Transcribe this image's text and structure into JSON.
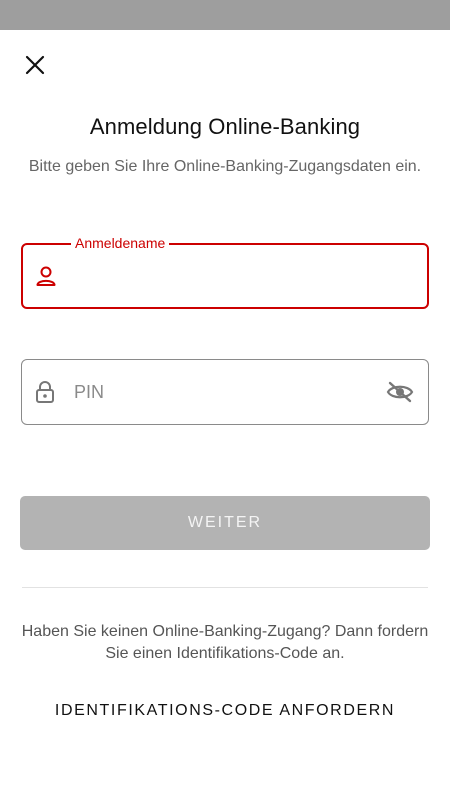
{
  "header": {
    "close_icon": "close-icon",
    "title": "Anmeldung Online-Banking",
    "subtitle": "Bitte geben Sie Ihre Online-Banking-Zugangsdaten ein."
  },
  "form": {
    "username": {
      "label": "Anmeldename",
      "value": "",
      "icon": "user-icon"
    },
    "pin": {
      "placeholder": "PIN",
      "value": "",
      "icon": "lock-icon",
      "toggle_icon": "eye-off-icon"
    },
    "submit_label": "WEITER"
  },
  "footer": {
    "info": "Haben Sie keinen Online-Banking-Zugang? Dann fordern Sie einen Identifikations-Code an.",
    "request_code_label": "IDENTIFIKATIONS-CODE ANFORDERN"
  },
  "colors": {
    "accent": "#cc0000",
    "disabled_button": "#b3b3b3",
    "status_bar": "#9e9e9e"
  }
}
